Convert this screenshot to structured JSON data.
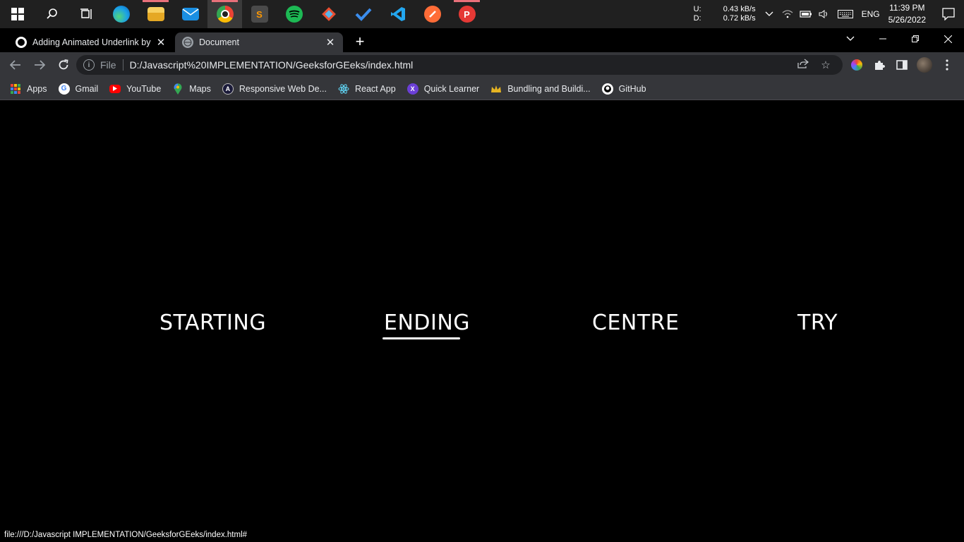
{
  "taskbar": {
    "apps": [
      {
        "name": "windows-start",
        "label": "",
        "color": "#ffffff"
      },
      {
        "name": "search",
        "label": "",
        "color": "#ffffff"
      },
      {
        "name": "task-view",
        "label": "",
        "color": "#ffffff"
      },
      {
        "name": "edge",
        "label": "",
        "color": "#1aa0e8"
      },
      {
        "name": "file-explorer",
        "label": "",
        "color": "#f4c542"
      },
      {
        "name": "mail",
        "label": "",
        "color": "#1a8fe3"
      },
      {
        "name": "chrome",
        "label": "",
        "color": "#34a853"
      },
      {
        "name": "sublime-text",
        "label": "S",
        "color": "#ff9800"
      },
      {
        "name": "spotify",
        "label": "",
        "color": "#1db954"
      },
      {
        "name": "git",
        "label": "",
        "color": "#e94e31"
      },
      {
        "name": "todo",
        "label": "",
        "color": "#3b8ded"
      },
      {
        "name": "vscode",
        "label": "",
        "color": "#23a7f0"
      },
      {
        "name": "postman",
        "label": "",
        "color": "#ff6c37"
      },
      {
        "name": "psiphon",
        "label": "P",
        "color": "#e53935"
      }
    ],
    "network": {
      "up_label": "U:",
      "up_value": "0.43 kB/s",
      "down_label": "D:",
      "down_value": "0.72 kB/s"
    },
    "language": "ENG",
    "time": "11:39 PM",
    "date": "5/26/2022"
  },
  "tabs": [
    {
      "title": "Adding Animated Underlink by S",
      "active": false
    },
    {
      "title": "Document",
      "active": true
    }
  ],
  "omnibox": {
    "scheme_label": "File",
    "url": "D:/Javascript%20IMPLEMENTATION/GeeksforGEeks/index.html"
  },
  "bookmarks": [
    {
      "label": "Apps"
    },
    {
      "label": "Gmail"
    },
    {
      "label": "YouTube"
    },
    {
      "label": "Maps"
    },
    {
      "label": "Responsive Web De..."
    },
    {
      "label": "React App"
    },
    {
      "label": "Quick Learner"
    },
    {
      "label": "Bundling and Buildi..."
    },
    {
      "label": "GitHub"
    }
  ],
  "page": {
    "links": [
      "STARTING",
      "ENDING",
      "CENTRE",
      "TRY"
    ],
    "hovered_link": "ENDING"
  },
  "status_url": "file:///D:/Javascript IMPLEMENTATION/GeeksforGEeks/index.html#"
}
